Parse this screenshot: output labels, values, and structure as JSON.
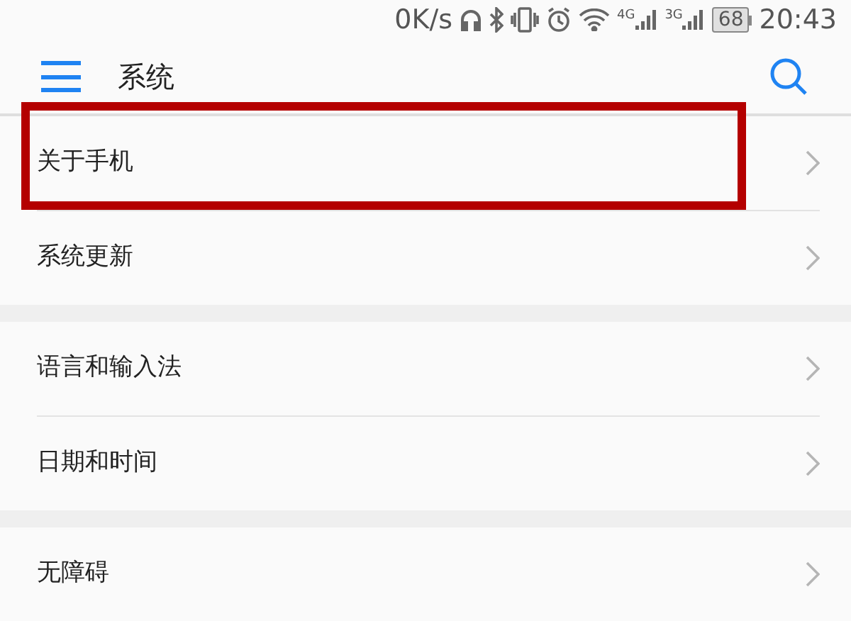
{
  "status_bar": {
    "speed": "0K/s",
    "network_1": "4G",
    "network_2": "3G",
    "battery": "68",
    "time": "20:43"
  },
  "header": {
    "title": "系统"
  },
  "groups": [
    {
      "items": [
        {
          "label": "关于手机",
          "highlighted": true
        },
        {
          "label": "系统更新",
          "highlighted": false
        }
      ]
    },
    {
      "items": [
        {
          "label": "语言和输入法",
          "highlighted": false
        },
        {
          "label": "日期和时间",
          "highlighted": false
        }
      ]
    },
    {
      "items": [
        {
          "label": "无障碍",
          "highlighted": false
        }
      ]
    }
  ]
}
